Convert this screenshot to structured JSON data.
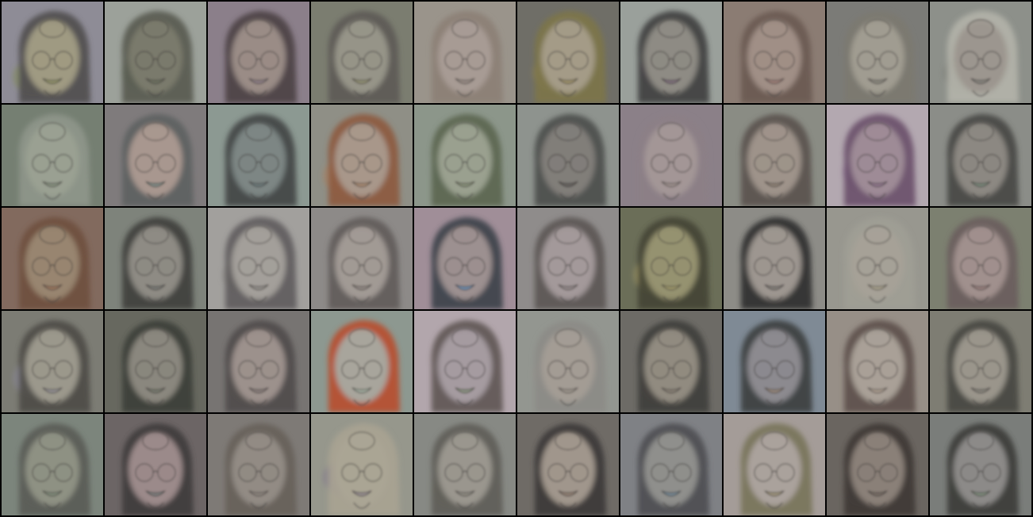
{
  "grid": {
    "rows": 5,
    "columns": 10,
    "tiles": [
      {
        "bg": "#8e8c96",
        "hair": "#4f4c4c",
        "skin": "#9f9a82",
        "accent": "#7f8a48"
      },
      {
        "bg": "#9ca19a",
        "hair": "#585a4f",
        "skin": "#7a7a6c",
        "accent": "#5f6b52"
      },
      {
        "bg": "#8b7f8a",
        "hair": "#4a4143",
        "skin": "#9a8c86",
        "accent": "#7d6f8a"
      },
      {
        "bg": "#7b7d70",
        "hair": "#5c5a55",
        "skin": "#969488",
        "accent": "#8f8f58"
      },
      {
        "bg": "#9a948b",
        "hair": "#8c7f76",
        "skin": "#a79b94",
        "accent": "#8a7a76"
      },
      {
        "bg": "#6f6e67",
        "hair": "#7d7648",
        "skin": "#a49b87",
        "accent": "#9c8a46"
      },
      {
        "bg": "#9aa09b",
        "hair": "#3f3d3e",
        "skin": "#8e8b84",
        "accent": "#6a4a73"
      },
      {
        "bg": "#8b7c73",
        "hair": "#6a5a52",
        "skin": "#a08f86",
        "accent": "#9d6a66"
      },
      {
        "bg": "#7b7b77",
        "hair": "#7c7970",
        "skin": "#a09c91",
        "accent": "#6f6f67"
      },
      {
        "bg": "#8d908a",
        "hair": "#b4b4aa",
        "skin": "#9c968f",
        "accent": "#6a6c66"
      },
      {
        "bg": "#757f72",
        "hair": "#8f968b",
        "skin": "#9aa092",
        "accent": "#6c7f66"
      },
      {
        "bg": "#7f7b7c",
        "hair": "#5d605f",
        "skin": "#a8978f",
        "accent": "#4b7a7c"
      },
      {
        "bg": "#8c9992",
        "hair": "#404344",
        "skin": "#7d8684",
        "accent": "#556a70"
      },
      {
        "bg": "#8f8f86",
        "hair": "#8d5a3f",
        "skin": "#a8978a",
        "accent": "#b07a53"
      },
      {
        "bg": "#8c968a",
        "hair": "#5b6550",
        "skin": "#9aa08f",
        "accent": "#6d7a59"
      },
      {
        "bg": "#8e938e",
        "hair": "#4a4c4a",
        "skin": "#817e79",
        "accent": "#3a3a3a"
      },
      {
        "bg": "#8b8088",
        "hair": "#8c7f86",
        "skin": "#a39696",
        "accent": "#9e8f8a"
      },
      {
        "bg": "#8a8c84",
        "hair": "#5a524c",
        "skin": "#9e938a",
        "accent": "#776a5c"
      },
      {
        "bg": "#b3a8b0",
        "hair": "#6a4f6a",
        "skin": "#9e8b96",
        "accent": "#7e5c84"
      },
      {
        "bg": "#8b8d88",
        "hair": "#454643",
        "skin": "#8c8882",
        "accent": "#5f8a70"
      },
      {
        "bg": "#826a5e",
        "hair": "#6e4f3f",
        "skin": "#98856f",
        "accent": "#a06246"
      },
      {
        "bg": "#7e837b",
        "hair": "#3d3e3c",
        "skin": "#8e8b84",
        "accent": "#5f6360"
      },
      {
        "bg": "#a2a09d",
        "hair": "#5e5b5c",
        "skin": "#a39f9a",
        "accent": "#7d7b78"
      },
      {
        "bg": "#8d8a88",
        "hair": "#5f5b59",
        "skin": "#a19a94",
        "accent": "#7a736e"
      },
      {
        "bg": "#a08e98",
        "hair": "#3b4148",
        "skin": "#9c9090",
        "accent": "#2c8ad8"
      },
      {
        "bg": "#8f8c8b",
        "hair": "#5b5553",
        "skin": "#a3999a",
        "accent": "#7f7676"
      },
      {
        "bg": "#6b6e58",
        "hair": "#444435",
        "skin": "#95926f",
        "accent": "#b0a268"
      },
      {
        "bg": "#8d8c87",
        "hair": "#2f2f2f",
        "skin": "#9d9690",
        "accent": "#5a5a56"
      },
      {
        "bg": "#98978f",
        "hair": "#a09f95",
        "skin": "#a6a197",
        "accent": "#b3aa88"
      },
      {
        "bg": "#7c8070",
        "hair": "#6a5c5c",
        "skin": "#a0908d",
        "accent": "#8e6a6a"
      },
      {
        "bg": "#7c7c74",
        "hair": "#4e4b47",
        "skin": "#9b988c",
        "accent": "#8c8aa0"
      },
      {
        "bg": "#67685f",
        "hair": "#3b3d38",
        "skin": "#8a877e",
        "accent": "#5e6a5a"
      },
      {
        "bg": "#777472",
        "hair": "#4f4b4a",
        "skin": "#9c918c",
        "accent": "#6f6563"
      },
      {
        "bg": "#8d9890",
        "hair": "#b84e2c",
        "skin": "#a8a59c",
        "accent": "#9ab7a4"
      },
      {
        "bg": "#b2a6ac",
        "hair": "#5e5553",
        "skin": "#a59ba0",
        "accent": "#6b8c58"
      },
      {
        "bg": "#939690",
        "hair": "#8c8b86",
        "skin": "#a39c94",
        "accent": "#9a918a"
      },
      {
        "bg": "#6d6b66",
        "hair": "#3f3d3a",
        "skin": "#918b80",
        "accent": "#7a7368"
      },
      {
        "bg": "#7f8a95",
        "hair": "#3a3d3e",
        "skin": "#8c8a8f",
        "accent": "#a88860"
      },
      {
        "bg": "#978f87",
        "hair": "#5c504a",
        "skin": "#a9a097",
        "accent": "#b29d8a"
      },
      {
        "bg": "#7e7d73",
        "hair": "#454540",
        "skin": "#9a958b",
        "accent": "#6e6d66"
      },
      {
        "bg": "#7c857c",
        "hair": "#5a5b55",
        "skin": "#8e9183",
        "accent": "#6f866f"
      },
      {
        "bg": "#6c6565",
        "hair": "#3f3a3b",
        "skin": "#9b8a8a",
        "accent": "#4f6a6a"
      },
      {
        "bg": "#7e7a76",
        "hair": "#665f59",
        "skin": "#928b84",
        "accent": "#8a7f77"
      },
      {
        "bg": "#96978c",
        "hair": "#a9a392",
        "skin": "#aaa594",
        "accent": "#7a6c8c"
      },
      {
        "bg": "#878984",
        "hair": "#5e5d57",
        "skin": "#9a968e",
        "accent": "#7d7a72"
      },
      {
        "bg": "#6f6b66",
        "hair": "#3b3836",
        "skin": "#a0968c",
        "accent": "#7a5f4c"
      },
      {
        "bg": "#7f8185",
        "hair": "#4c4e52",
        "skin": "#8f8f8c",
        "accent": "#4f7fa0"
      },
      {
        "bg": "#a49c98",
        "hair": "#78745a",
        "skin": "#aaa29c",
        "accent": "#8e8550"
      },
      {
        "bg": "#6a6560",
        "hair": "#3d3835",
        "skin": "#8a8078",
        "accent": "#5c5048"
      },
      {
        "bg": "#7a7d7a",
        "hair": "#3a3b39",
        "skin": "#8c8a88",
        "accent": "#6b8f6b"
      }
    ]
  }
}
